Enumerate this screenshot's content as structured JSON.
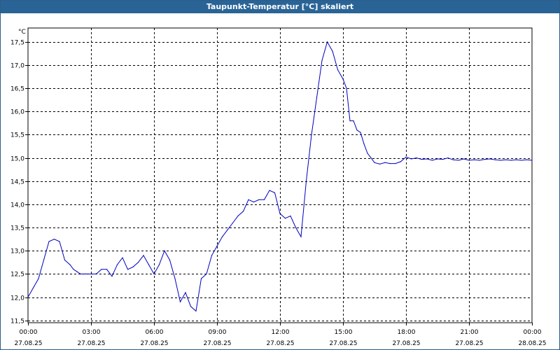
{
  "window": {
    "title": "Taupunkt-Temperatur [°C] skaliert"
  },
  "colors": {
    "titlebar": "#2a6496",
    "series": "#0000c0",
    "grid": "#000000"
  },
  "chart_data": {
    "type": "line",
    "title": "Taupunkt-Temperatur [°C] skaliert",
    "ylabel": "°C",
    "ylim": [
      11.45,
      17.8
    ],
    "xlim": [
      "27.08.25 00:00",
      "28.08.25 00:00"
    ],
    "grid": true,
    "y_ticks": [
      "11,5",
      "12,0",
      "12,5",
      "13,0",
      "13,5",
      "14,0",
      "14,5",
      "15,0",
      "15,5",
      "16,0",
      "16,5",
      "17,0",
      "17,5"
    ],
    "x_ticks": [
      {
        "time": "00:00",
        "date": "27.08.25"
      },
      {
        "time": "03:00",
        "date": "27.08.25"
      },
      {
        "time": "06:00",
        "date": "27.08.25"
      },
      {
        "time": "09:00",
        "date": "27.08.25"
      },
      {
        "time": "12:00",
        "date": "27.08.25"
      },
      {
        "time": "15:00",
        "date": "27.08.25"
      },
      {
        "time": "18:00",
        "date": "27.08.25"
      },
      {
        "time": "21:00",
        "date": "27.08.25"
      },
      {
        "time": "00:00",
        "date": "28.08.25"
      }
    ],
    "series": [
      {
        "color": "#0000c0",
        "x": [
          "00:00",
          "00:15",
          "00:30",
          "00:45",
          "01:00",
          "01:15",
          "01:30",
          "01:45",
          "02:00",
          "02:10",
          "02:20",
          "02:30",
          "02:45",
          "03:00",
          "03:15",
          "03:30",
          "03:45",
          "04:00",
          "04:15",
          "04:30",
          "04:45",
          "05:00",
          "05:15",
          "05:30",
          "05:45",
          "06:00",
          "06:15",
          "06:30",
          "06:45",
          "07:00",
          "07:15",
          "07:30",
          "07:45",
          "08:00",
          "08:15",
          "08:30",
          "08:45",
          "09:00",
          "09:15",
          "09:30",
          "09:45",
          "10:00",
          "10:15",
          "10:30",
          "10:45",
          "11:00",
          "11:15",
          "11:30",
          "11:45",
          "12:00",
          "12:15",
          "12:30",
          "12:45",
          "13:00",
          "13:15",
          "13:30",
          "13:45",
          "14:00",
          "14:15",
          "14:30",
          "14:45",
          "15:00",
          "15:10",
          "15:20",
          "15:30",
          "15:40",
          "15:50",
          "16:00",
          "16:10",
          "16:20",
          "16:30",
          "16:45",
          "17:00",
          "17:15",
          "17:30",
          "17:45",
          "18:00",
          "18:15",
          "18:30",
          "18:45",
          "19:00",
          "19:15",
          "19:30",
          "19:45",
          "20:00",
          "20:15",
          "20:30",
          "20:45",
          "21:00",
          "21:15",
          "21:30",
          "21:45",
          "22:00",
          "22:15",
          "22:30",
          "22:45",
          "23:00",
          "23:15",
          "23:30",
          "23:45",
          "24:00"
        ],
        "values": [
          12.0,
          12.2,
          12.4,
          12.8,
          13.2,
          13.25,
          13.2,
          12.8,
          12.7,
          12.6,
          12.55,
          12.5,
          12.5,
          12.5,
          12.5,
          12.6,
          12.6,
          12.45,
          12.7,
          12.85,
          12.6,
          12.65,
          12.75,
          12.9,
          12.7,
          12.5,
          12.7,
          13.0,
          12.8,
          12.4,
          11.9,
          12.1,
          11.8,
          11.7,
          12.4,
          12.5,
          12.9,
          13.1,
          13.3,
          13.45,
          13.6,
          13.75,
          13.85,
          14.1,
          14.05,
          14.1,
          14.1,
          14.3,
          14.25,
          13.8,
          13.7,
          13.75,
          13.5,
          13.3,
          14.5,
          15.5,
          16.3,
          17.1,
          17.5,
          17.3,
          16.9,
          16.7,
          16.5,
          15.8,
          15.8,
          15.6,
          15.55,
          15.3,
          15.1,
          15.0,
          14.9,
          14.87,
          14.9,
          14.88,
          14.88,
          14.92,
          15.02,
          14.98,
          15.0,
          14.97,
          14.98,
          14.95,
          14.98,
          14.97,
          15.0,
          14.96,
          14.95,
          14.98,
          14.95,
          14.96,
          14.95,
          14.97,
          14.98,
          14.96,
          14.95,
          14.96,
          14.95,
          14.96,
          14.95,
          14.96,
          14.95
        ]
      }
    ]
  }
}
